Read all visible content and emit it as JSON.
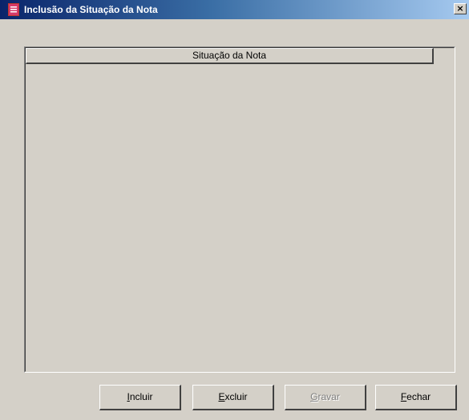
{
  "window": {
    "title": "Inclusão da Situação da Nota",
    "close_label": "×"
  },
  "grid": {
    "columns": [
      "Situação da Nota"
    ],
    "rows": []
  },
  "buttons": {
    "incluir": {
      "accel": "I",
      "rest": "ncluir",
      "enabled": true
    },
    "excluir": {
      "accel": "E",
      "rest": "xcluir",
      "enabled": true
    },
    "gravar": {
      "accel": "G",
      "rest": "ravar",
      "enabled": false
    },
    "fechar": {
      "accel": "F",
      "rest": "echar",
      "enabled": true
    }
  }
}
